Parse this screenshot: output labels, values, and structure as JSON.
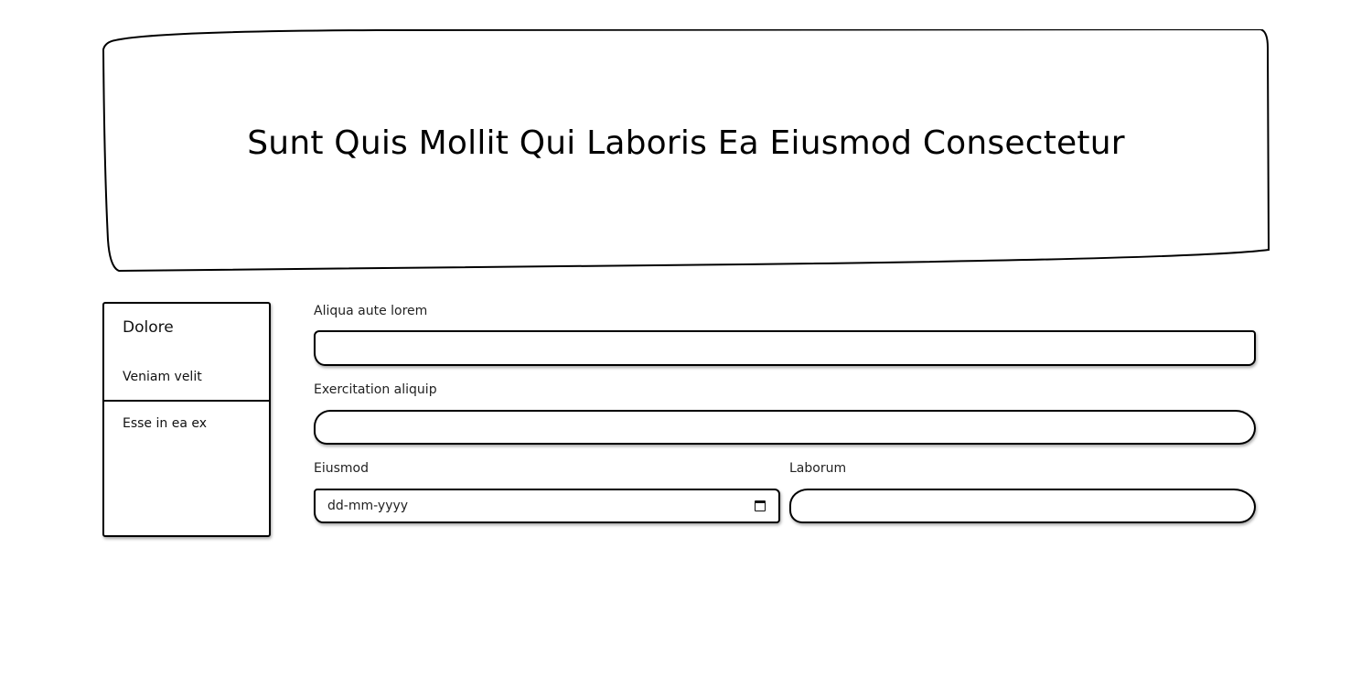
{
  "header": {
    "title": "Sunt Quis Mollit Qui Laboris Ea Eiusmod Consectetur"
  },
  "sidebar": {
    "heading": "Dolore",
    "items": [
      {
        "label": "Veniam velit"
      },
      {
        "label": "Esse in ea ex"
      }
    ]
  },
  "form": {
    "fields": [
      {
        "label": "Aliqua aute lorem",
        "value": ""
      },
      {
        "label": "Exercitation aliquip",
        "value": ""
      },
      {
        "label": "Eiusmod",
        "placeholder": "dd-mm-yyyy",
        "value": "",
        "icon": "calendar-icon"
      },
      {
        "label": "Laborum",
        "value": ""
      }
    ]
  }
}
